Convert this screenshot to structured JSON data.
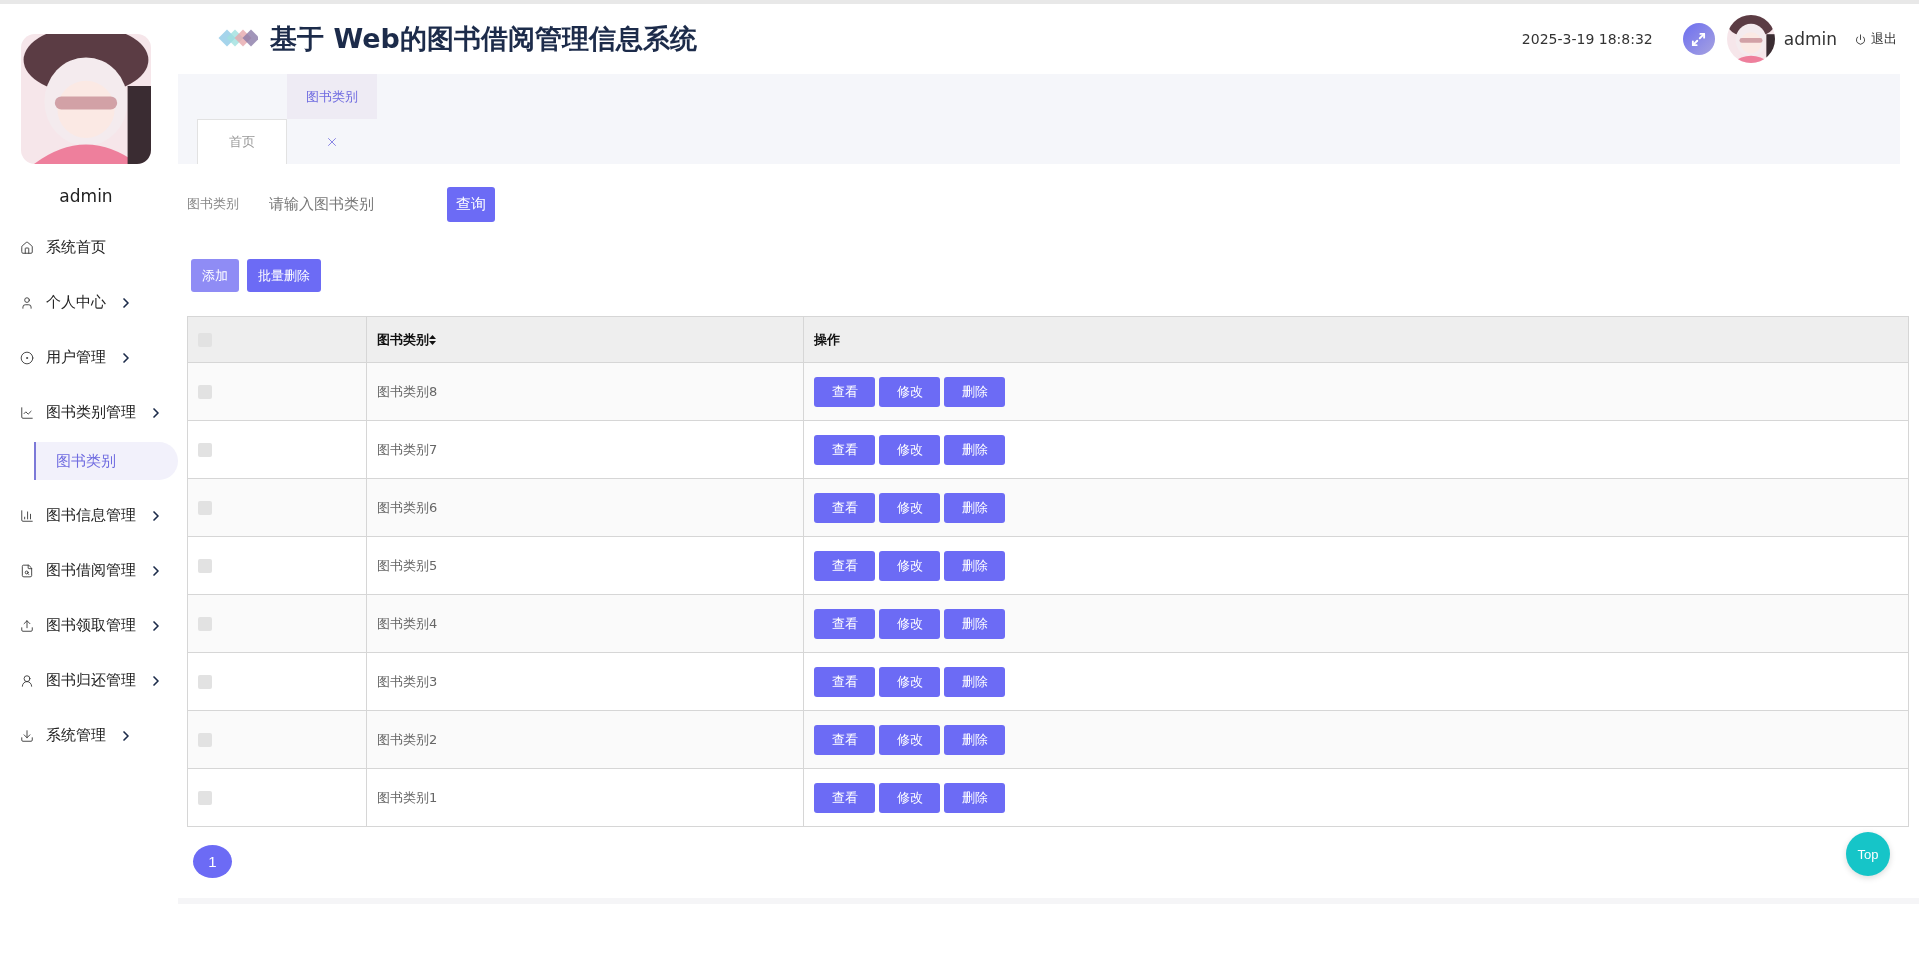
{
  "sidebar": {
    "user": "admin",
    "items": [
      {
        "kind": "link",
        "label": "系统首页"
      },
      {
        "kind": "group",
        "label": "个人中心"
      },
      {
        "kind": "group",
        "label": "用户管理"
      },
      {
        "kind": "group",
        "label": "图书类别管理",
        "children": [
          {
            "label": "图书类别",
            "selected": true
          }
        ]
      },
      {
        "kind": "group",
        "label": "图书信息管理"
      },
      {
        "kind": "group",
        "label": "图书借阅管理"
      },
      {
        "kind": "group",
        "label": "图书领取管理"
      },
      {
        "kind": "group",
        "label": "图书归还管理"
      },
      {
        "kind": "group",
        "label": "系统管理"
      }
    ]
  },
  "header": {
    "title": "基于 Web的图书借阅管理信息系统",
    "datetime": "2025-3-19 18:8:32",
    "user": "admin",
    "logout": "退出"
  },
  "tabs": [
    {
      "label": "首页",
      "selected": false
    },
    {
      "label": "图书类别",
      "selected": true
    }
  ],
  "search": {
    "label": "图书类别",
    "placeholder": "请输入图书类别",
    "button": "查询"
  },
  "toolbar": [
    {
      "label": "添加",
      "hovered": true
    },
    {
      "label": "批量删除",
      "hovered": false
    }
  ],
  "table": {
    "columns": [
      {
        "label": "图书类别",
        "sortable": true
      },
      {
        "label": "操作",
        "sortable": false
      }
    ],
    "header_checked": false,
    "rows": [
      {
        "checked": false,
        "category": "图书类别8",
        "actions": [
          "查看",
          "修改",
          "删除"
        ]
      },
      {
        "checked": false,
        "category": "图书类别7",
        "actions": [
          "查看",
          "修改",
          "删除"
        ]
      },
      {
        "checked": false,
        "category": "图书类别6",
        "actions": [
          "查看",
          "修改",
          "删除"
        ]
      },
      {
        "checked": false,
        "category": "图书类别5",
        "actions": [
          "查看",
          "修改",
          "删除"
        ]
      },
      {
        "checked": false,
        "category": "图书类别4",
        "actions": [
          "查看",
          "修改",
          "删除"
        ]
      },
      {
        "checked": false,
        "category": "图书类别3",
        "actions": [
          "查看",
          "修改",
          "删除"
        ]
      },
      {
        "checked": false,
        "category": "图书类别2",
        "actions": [
          "查看",
          "修改",
          "删除"
        ]
      },
      {
        "checked": false,
        "category": "图书类别1",
        "actions": [
          "查看",
          "修改",
          "删除"
        ]
      }
    ]
  },
  "pagination": [
    {
      "label": "1",
      "selected": true
    }
  ],
  "back_to_top": "Top"
}
